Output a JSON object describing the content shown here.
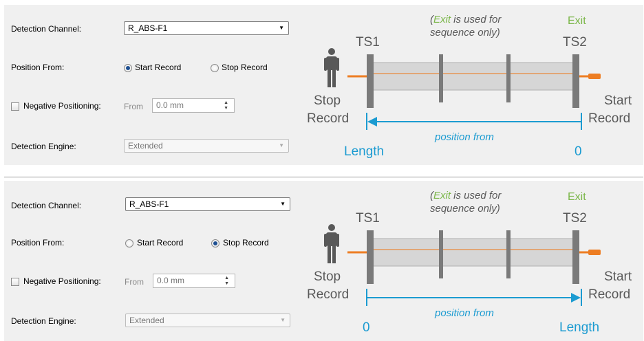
{
  "panels": [
    {
      "detection_channel_label": "Detection Channel:",
      "detection_channel_value": "R_ABS-F1",
      "position_from_label": "Position From:",
      "start_record_label": "Start Record",
      "stop_record_label": "Stop Record",
      "position_from_selected": "Start Record",
      "negative_positioning_label": "Negative Positioning:",
      "negative_positioning_checked": false,
      "from_label": "From",
      "from_value": "0.0 mm",
      "detection_engine_label": "Detection Engine:",
      "detection_engine_value": "Extended",
      "diagram": {
        "exit_top": "Exit",
        "note_exit": "Exit",
        "note_rest1": " is used for",
        "note_line2": "sequence only)",
        "note_open": "(",
        "ts1": "TS1",
        "ts2": "TS2",
        "stop_line1": "Stop",
        "stop_line2": "Record",
        "start_line1": "Start",
        "start_line2": "Record",
        "arrow_label": "position from",
        "left_end_label": "Length",
        "right_end_label": "0",
        "arrow_direction": "left"
      }
    },
    {
      "detection_channel_label": "Detection Channel:",
      "detection_channel_value": "R_ABS-F1",
      "position_from_label": "Position From:",
      "start_record_label": "Start Record",
      "stop_record_label": "Stop Record",
      "position_from_selected": "Stop Record",
      "negative_positioning_label": "Negative Positioning:",
      "negative_positioning_checked": false,
      "from_label": "From",
      "from_value": "0.0 mm",
      "detection_engine_label": "Detection Engine:",
      "detection_engine_value": "Extended",
      "diagram": {
        "exit_top": "Exit",
        "note_exit": "Exit",
        "note_rest1": " is used for",
        "note_line2": "sequence only)",
        "note_open": "(",
        "ts1": "TS1",
        "ts2": "TS2",
        "stop_line1": "Stop",
        "stop_line2": "Record",
        "start_line1": "Start",
        "start_line2": "Record",
        "arrow_label": "position from",
        "left_end_label": "0",
        "right_end_label": "Length",
        "arrow_direction": "right"
      }
    }
  ],
  "colors": {
    "green": "#7ab648",
    "blue": "#1b9bd1",
    "orange": "#ed7d22",
    "post": "#7a7a7a",
    "text_gray": "#595959",
    "channel": "#d6d6d6"
  },
  "icons": [
    "person-icon",
    "dropdown-arrow-icon",
    "spinner-arrows-icon"
  ]
}
